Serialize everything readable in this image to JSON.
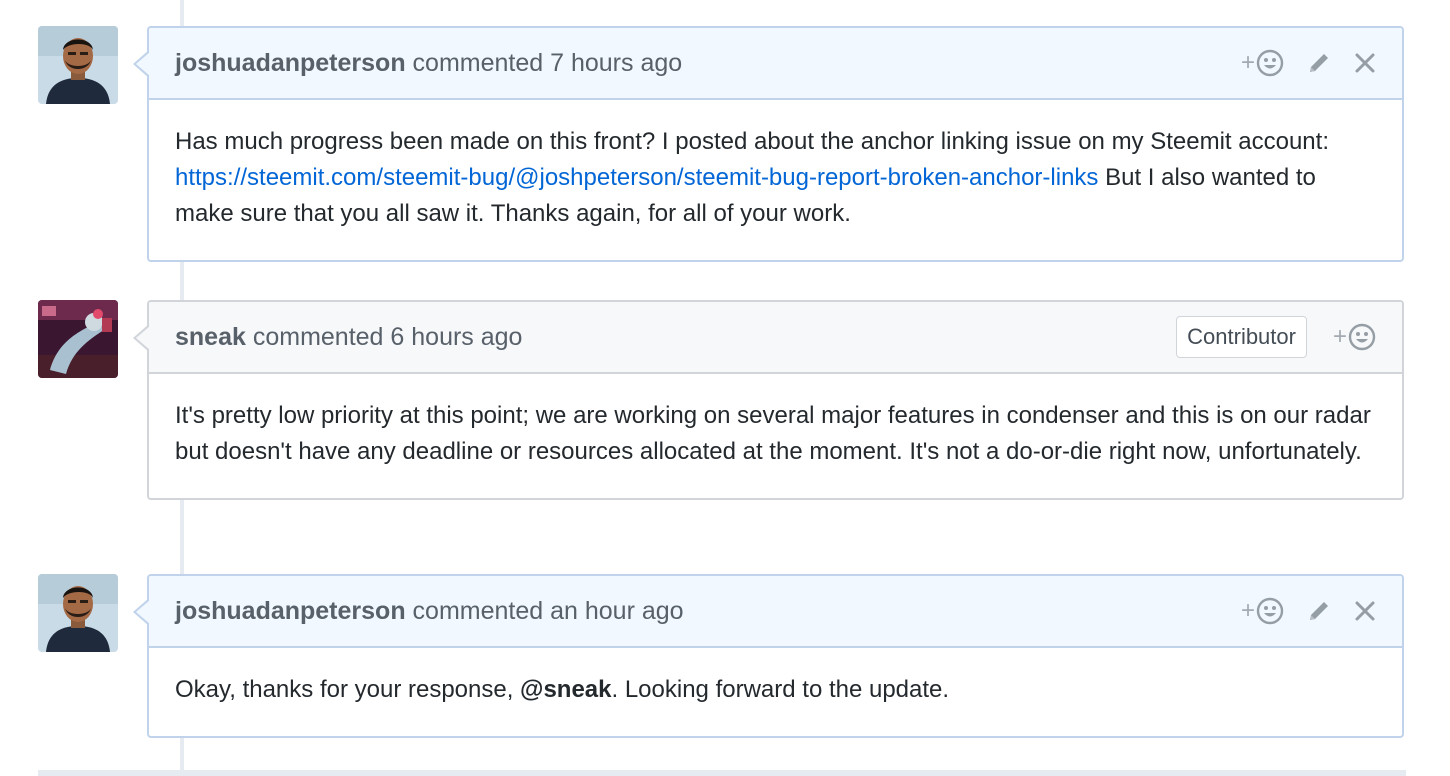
{
  "comments": [
    {
      "author": "joshuadanpeterson",
      "action": "commented",
      "time": "7 hours ago",
      "body_part1": "Has much progress been made on this front? I posted about the anchor linking issue on my Steemit account: ",
      "link_text": "https://steemit.com/steemit-bug/@joshpeterson/steemit-bug-report-broken-anchor-links",
      "body_part2": " But I also wanted to make sure that you all saw it. Thanks again, for all of your work."
    },
    {
      "author": "sneak",
      "action": "commented",
      "time": "6 hours ago",
      "badge": "Contributor",
      "body": "It's pretty low priority at this point; we are working on several major features in condenser and this is on our radar but doesn't have any deadline or resources allocated at the moment. It's not a do-or-die right now, unfortunately."
    },
    {
      "author": "joshuadanpeterson",
      "action": "commented",
      "time": "an hour ago",
      "body_part1": "Okay, thanks for your response, ",
      "mention": "@sneak",
      "body_part2": ". Looking forward to the update."
    }
  ],
  "icons": {
    "reaction": "add-reaction-smiley-icon",
    "edit": "pencil-icon",
    "delete": "close-x-icon",
    "plus_glyph": "+"
  },
  "colors": {
    "header_own": "#f1f8ff",
    "border_own": "#c0d3eb",
    "header_other": "#f6f8fa",
    "border_other": "#d1d5da",
    "link": "#0366d6"
  }
}
